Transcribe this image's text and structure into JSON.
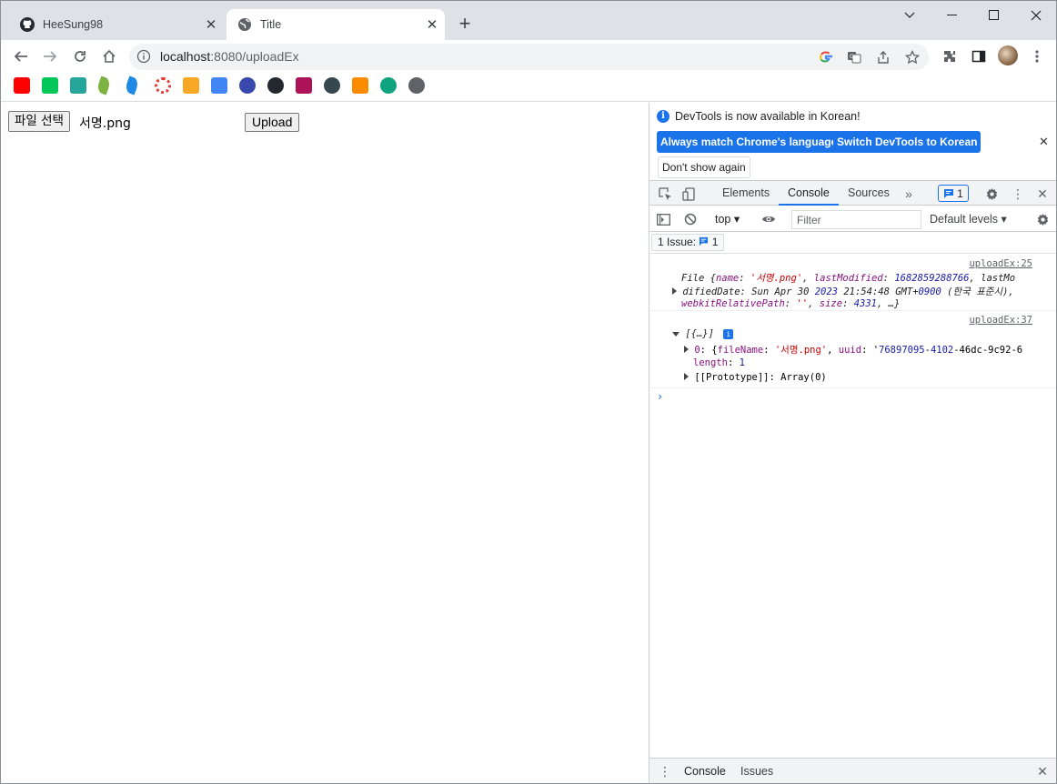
{
  "tabs": [
    {
      "title": "HeeSung98",
      "icon": "github-icon"
    },
    {
      "title": "Title",
      "icon": "globe-icon"
    }
  ],
  "address": {
    "host": "localhost",
    "path": ":8080/uploadEx"
  },
  "bookmarks": [
    {
      "name": "youtube-icon",
      "color": "#ff0000"
    },
    {
      "name": "naver-icon",
      "color": "#03c75a"
    },
    {
      "name": "bookmark-icon",
      "color": "#26a69a"
    },
    {
      "name": "leaf-icon",
      "color": "#7cb342"
    },
    {
      "name": "bird-icon",
      "color": "#1e88e5"
    },
    {
      "name": "circle-icon",
      "color": "#e53935"
    },
    {
      "name": "classroom-icon",
      "color": "#f9a825"
    },
    {
      "name": "docs-icon",
      "color": "#4285f4"
    },
    {
      "name": "owl-icon",
      "color": "#3949ab"
    },
    {
      "name": "github-icon",
      "color": "#24292f"
    },
    {
      "name": "image-icon",
      "color": "#ad1457"
    },
    {
      "name": "avatar-icon",
      "color": "#37474f"
    },
    {
      "name": "cube-icon",
      "color": "#fb8c00"
    },
    {
      "name": "openai-icon",
      "color": "#10a37f"
    },
    {
      "name": "globe-icon",
      "color": "#5f6368"
    }
  ],
  "page": {
    "file_button": "파일 선택",
    "file_name": "서명.png",
    "upload_button": "Upload"
  },
  "devtools": {
    "infobar": {
      "message": "DevTools is now available in Korean!",
      "match_button": "Always match Chrome's language",
      "switch_button": "Switch DevTools to Korean",
      "dont_show": "Don't show again"
    },
    "tabs": [
      "Elements",
      "Console",
      "Sources"
    ],
    "issue_badge_count": "1",
    "console_toolbar": {
      "context": "top",
      "filter_placeholder": "Filter",
      "levels": "Default levels"
    },
    "issues_chip": {
      "label": "1 Issue:",
      "count": "1"
    },
    "messages": [
      {
        "source": "uploadEx:25",
        "line1": "File {name: '서명.png', lastModified: 1682859288766, lastMo",
        "line2": "difiedDate: Sun Apr 30 2023 21:54:48 GMT+0900 (한국 표준시),",
        "line3": "webkitRelativePath: '', size: 4331, …}"
      },
      {
        "source": "uploadEx:37",
        "summary": "[{…}]",
        "item0": "0: {fileName: '서명.png', uuid: '76897095-4102-46dc-9c92-6",
        "length_label": "length",
        "length_value": "1",
        "prototype": "[[Prototype]]: Array(0)"
      }
    ],
    "drawer_tabs": [
      "Console",
      "Issues"
    ]
  }
}
